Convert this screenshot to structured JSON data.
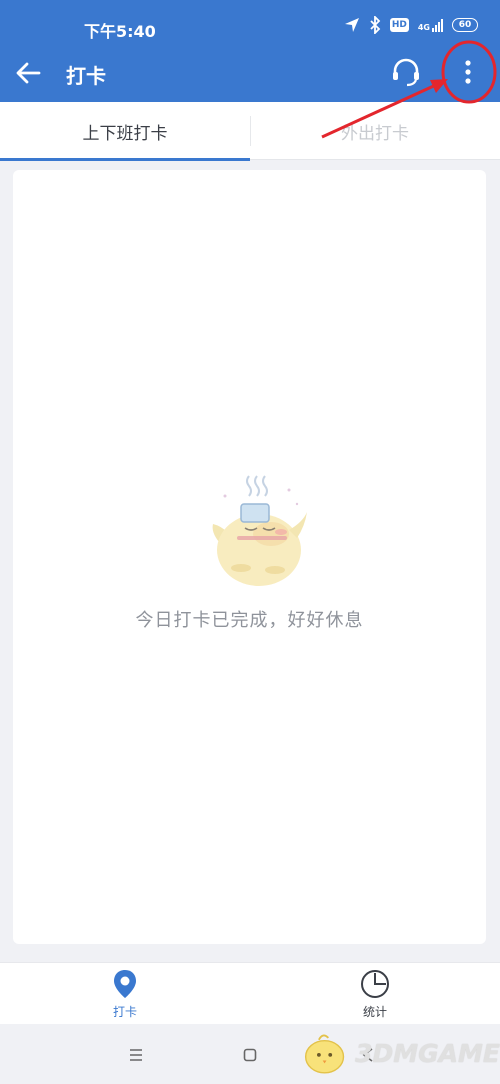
{
  "status_bar": {
    "time": "下午5:40",
    "network": "4G",
    "hd_badge": "HD",
    "battery": "60"
  },
  "header": {
    "title": "打卡",
    "background_color": "#3a78cf"
  },
  "tabs": [
    {
      "label": "上下班打卡",
      "active": true
    },
    {
      "label": "外出打卡",
      "active": false
    }
  ],
  "empty_state": {
    "message": "今日打卡已完成，好好休息",
    "icon": "sleeping-chick-illustration"
  },
  "bottom_nav": [
    {
      "label": "打卡",
      "icon": "location-pin-icon",
      "active": true
    },
    {
      "label": "统计",
      "icon": "clock-icon",
      "active": false
    }
  ],
  "watermark": {
    "text": "3DMGAME"
  },
  "colors": {
    "accent": "#3a78cf",
    "annotation": "#e3262d"
  }
}
